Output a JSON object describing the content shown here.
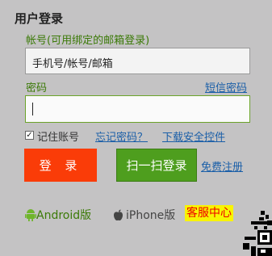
{
  "title": "用户登录",
  "account": {
    "label": "帐号(可用绑定的邮箱登录)",
    "value": "手机号/帐号/邮箱"
  },
  "password": {
    "label": "密码",
    "sms_link": "短信密码"
  },
  "options": {
    "remember_label": "记住账号",
    "remember_checked": true,
    "forgot_link": "忘记密码？",
    "download_link": "下载安全控件"
  },
  "buttons": {
    "login": "登 录",
    "scan": "扫一扫登录",
    "register": "免费注册"
  },
  "apps": {
    "android": "Android版",
    "iphone": "iPhone版",
    "service": "客服中心"
  },
  "colors": {
    "login_button": "#fa3c08",
    "scan_button": "#4e9e1e",
    "label_green": "#3b7a07",
    "link_blue": "#1b5fa8",
    "service_bg": "#f8f402",
    "service_text": "#e00000"
  },
  "icons": {
    "android": "android-icon",
    "apple": "apple-icon",
    "qr": "qr-code-icon"
  }
}
